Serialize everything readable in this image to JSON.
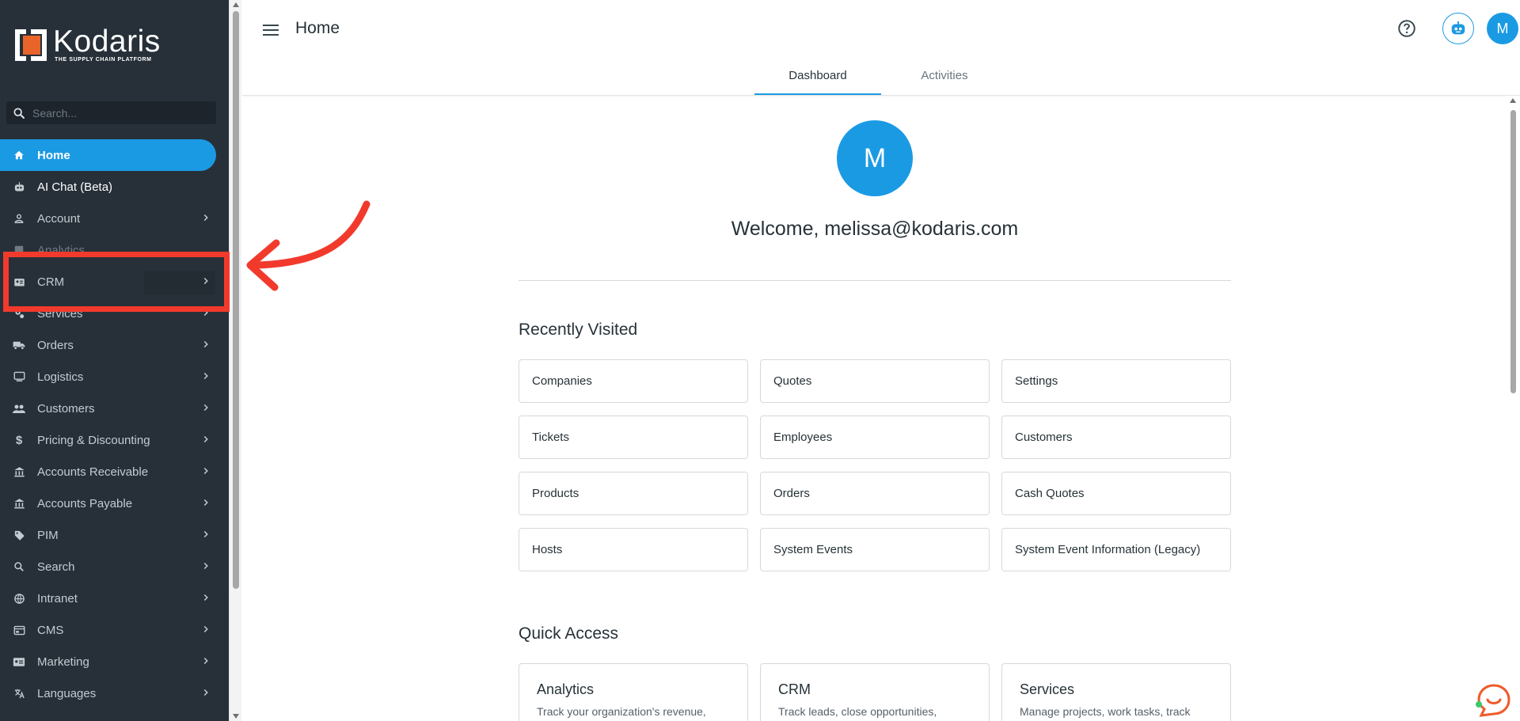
{
  "brand": {
    "name": "Kodaris",
    "tagline": "THE SUPPLY CHAIN PLATFORM",
    "accent": "#1b9ae4",
    "sidebar_bg": "#273039",
    "annotation_red": "#f23a2c"
  },
  "search": {
    "placeholder": "Search..."
  },
  "sidebar": {
    "items": [
      {
        "label": "Home",
        "icon": "home-icon"
      },
      {
        "label": "AI Chat (Beta)",
        "icon": "robot-icon"
      },
      {
        "label": "Account",
        "icon": "person-icon"
      },
      {
        "label": "Analytics",
        "icon": "chart-icon"
      },
      {
        "label": "CRM",
        "icon": "contact-card-icon"
      },
      {
        "label": "Services",
        "icon": "gears-icon"
      },
      {
        "label": "Orders",
        "icon": "truck-icon"
      },
      {
        "label": "Logistics",
        "icon": "logistics-icon"
      },
      {
        "label": "Customers",
        "icon": "people-icon"
      },
      {
        "label": "Pricing & Discounting",
        "icon": "dollar-icon"
      },
      {
        "label": "Accounts Receivable",
        "icon": "bank-icon"
      },
      {
        "label": "Accounts Payable",
        "icon": "bank-icon"
      },
      {
        "label": "PIM",
        "icon": "tag-icon"
      },
      {
        "label": "Search",
        "icon": "search-icon"
      },
      {
        "label": "Intranet",
        "icon": "globe-icon"
      },
      {
        "label": "CMS",
        "icon": "cms-icon"
      },
      {
        "label": "Marketing",
        "icon": "marketing-icon"
      },
      {
        "label": "Languages",
        "icon": "translate-icon"
      }
    ]
  },
  "header": {
    "title": "Home",
    "avatar_initial": "M"
  },
  "tabs": [
    {
      "label": "Dashboard"
    },
    {
      "label": "Activities"
    }
  ],
  "main": {
    "avatar_initial": "M",
    "welcome": "Welcome, melissa@kodaris.com",
    "recently_visited": {
      "title": "Recently Visited",
      "items": [
        "Companies",
        "Quotes",
        "Settings",
        "Tickets",
        "Employees",
        "Customers",
        "Products",
        "Orders",
        "Cash Quotes",
        "Hosts",
        "System Events",
        "System Event Information (Legacy)"
      ]
    },
    "quick_access": {
      "title": "Quick Access",
      "items": [
        {
          "title": "Analytics",
          "desc": "Track your organization's revenue,"
        },
        {
          "title": "CRM",
          "desc": "Track leads, close opportunities,"
        },
        {
          "title": "Services",
          "desc": "Manage projects, work tasks, track"
        }
      ]
    }
  }
}
